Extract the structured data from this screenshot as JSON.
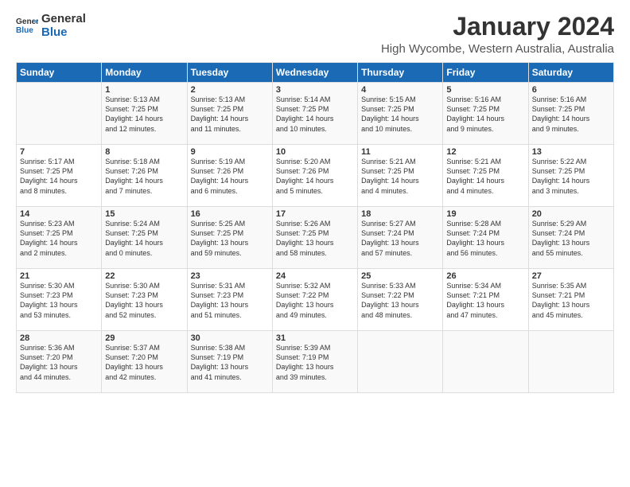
{
  "logo": {
    "line1": "General",
    "line2": "Blue"
  },
  "title": "January 2024",
  "subtitle": "High Wycombe, Western Australia, Australia",
  "days_of_week": [
    "Sunday",
    "Monday",
    "Tuesday",
    "Wednesday",
    "Thursday",
    "Friday",
    "Saturday"
  ],
  "weeks": [
    [
      {
        "num": "",
        "info": ""
      },
      {
        "num": "1",
        "info": "Sunrise: 5:13 AM\nSunset: 7:25 PM\nDaylight: 14 hours\nand 12 minutes."
      },
      {
        "num": "2",
        "info": "Sunrise: 5:13 AM\nSunset: 7:25 PM\nDaylight: 14 hours\nand 11 minutes."
      },
      {
        "num": "3",
        "info": "Sunrise: 5:14 AM\nSunset: 7:25 PM\nDaylight: 14 hours\nand 10 minutes."
      },
      {
        "num": "4",
        "info": "Sunrise: 5:15 AM\nSunset: 7:25 PM\nDaylight: 14 hours\nand 10 minutes."
      },
      {
        "num": "5",
        "info": "Sunrise: 5:16 AM\nSunset: 7:25 PM\nDaylight: 14 hours\nand 9 minutes."
      },
      {
        "num": "6",
        "info": "Sunrise: 5:16 AM\nSunset: 7:25 PM\nDaylight: 14 hours\nand 9 minutes."
      }
    ],
    [
      {
        "num": "7",
        "info": "Sunrise: 5:17 AM\nSunset: 7:25 PM\nDaylight: 14 hours\nand 8 minutes."
      },
      {
        "num": "8",
        "info": "Sunrise: 5:18 AM\nSunset: 7:26 PM\nDaylight: 14 hours\nand 7 minutes."
      },
      {
        "num": "9",
        "info": "Sunrise: 5:19 AM\nSunset: 7:26 PM\nDaylight: 14 hours\nand 6 minutes."
      },
      {
        "num": "10",
        "info": "Sunrise: 5:20 AM\nSunset: 7:26 PM\nDaylight: 14 hours\nand 5 minutes."
      },
      {
        "num": "11",
        "info": "Sunrise: 5:21 AM\nSunset: 7:25 PM\nDaylight: 14 hours\nand 4 minutes."
      },
      {
        "num": "12",
        "info": "Sunrise: 5:21 AM\nSunset: 7:25 PM\nDaylight: 14 hours\nand 4 minutes."
      },
      {
        "num": "13",
        "info": "Sunrise: 5:22 AM\nSunset: 7:25 PM\nDaylight: 14 hours\nand 3 minutes."
      }
    ],
    [
      {
        "num": "14",
        "info": "Sunrise: 5:23 AM\nSunset: 7:25 PM\nDaylight: 14 hours\nand 2 minutes."
      },
      {
        "num": "15",
        "info": "Sunrise: 5:24 AM\nSunset: 7:25 PM\nDaylight: 14 hours\nand 0 minutes."
      },
      {
        "num": "16",
        "info": "Sunrise: 5:25 AM\nSunset: 7:25 PM\nDaylight: 13 hours\nand 59 minutes."
      },
      {
        "num": "17",
        "info": "Sunrise: 5:26 AM\nSunset: 7:25 PM\nDaylight: 13 hours\nand 58 minutes."
      },
      {
        "num": "18",
        "info": "Sunrise: 5:27 AM\nSunset: 7:24 PM\nDaylight: 13 hours\nand 57 minutes."
      },
      {
        "num": "19",
        "info": "Sunrise: 5:28 AM\nSunset: 7:24 PM\nDaylight: 13 hours\nand 56 minutes."
      },
      {
        "num": "20",
        "info": "Sunrise: 5:29 AM\nSunset: 7:24 PM\nDaylight: 13 hours\nand 55 minutes."
      }
    ],
    [
      {
        "num": "21",
        "info": "Sunrise: 5:30 AM\nSunset: 7:23 PM\nDaylight: 13 hours\nand 53 minutes."
      },
      {
        "num": "22",
        "info": "Sunrise: 5:30 AM\nSunset: 7:23 PM\nDaylight: 13 hours\nand 52 minutes."
      },
      {
        "num": "23",
        "info": "Sunrise: 5:31 AM\nSunset: 7:23 PM\nDaylight: 13 hours\nand 51 minutes."
      },
      {
        "num": "24",
        "info": "Sunrise: 5:32 AM\nSunset: 7:22 PM\nDaylight: 13 hours\nand 49 minutes."
      },
      {
        "num": "25",
        "info": "Sunrise: 5:33 AM\nSunset: 7:22 PM\nDaylight: 13 hours\nand 48 minutes."
      },
      {
        "num": "26",
        "info": "Sunrise: 5:34 AM\nSunset: 7:21 PM\nDaylight: 13 hours\nand 47 minutes."
      },
      {
        "num": "27",
        "info": "Sunrise: 5:35 AM\nSunset: 7:21 PM\nDaylight: 13 hours\nand 45 minutes."
      }
    ],
    [
      {
        "num": "28",
        "info": "Sunrise: 5:36 AM\nSunset: 7:20 PM\nDaylight: 13 hours\nand 44 minutes."
      },
      {
        "num": "29",
        "info": "Sunrise: 5:37 AM\nSunset: 7:20 PM\nDaylight: 13 hours\nand 42 minutes."
      },
      {
        "num": "30",
        "info": "Sunrise: 5:38 AM\nSunset: 7:19 PM\nDaylight: 13 hours\nand 41 minutes."
      },
      {
        "num": "31",
        "info": "Sunrise: 5:39 AM\nSunset: 7:19 PM\nDaylight: 13 hours\nand 39 minutes."
      },
      {
        "num": "",
        "info": ""
      },
      {
        "num": "",
        "info": ""
      },
      {
        "num": "",
        "info": ""
      }
    ]
  ]
}
